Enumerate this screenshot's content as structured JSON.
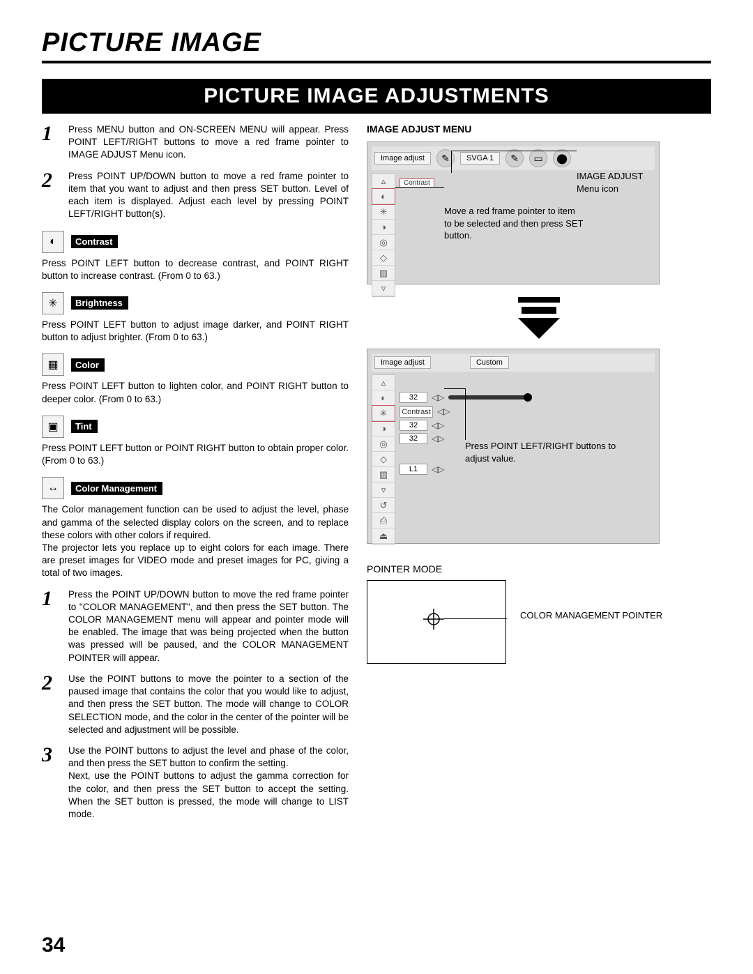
{
  "page_title": "PICTURE IMAGE",
  "section_banner": "PICTURE IMAGE ADJUSTMENTS",
  "page_number": "34",
  "steps_a": [
    {
      "num": "1",
      "text": "Press MENU button and ON-SCREEN MENU will appear.  Press POINT LEFT/RIGHT buttons to move a red frame pointer to IMAGE ADJUST Menu icon."
    },
    {
      "num": "2",
      "text": "Press POINT UP/DOWN button to move a red frame pointer to item that you want to adjust and then press SET button. Level of each item is displayed.  Adjust each level by pressing POINT LEFT/RIGHT button(s)."
    }
  ],
  "adjustments": [
    {
      "icon": "◐",
      "label": "Contrast",
      "text": "Press POINT LEFT button to decrease contrast, and POINT RIGHT button to increase contrast.  (From 0 to 63.)"
    },
    {
      "icon": "✳",
      "label": "Brightness",
      "text": "Press POINT LEFT button to adjust image darker, and POINT RIGHT button to adjust brighter.  (From 0 to 63.)"
    },
    {
      "icon": "▦",
      "label": "Color",
      "text": "Press POINT LEFT button to lighten color, and POINT RIGHT button to deeper color.  (From 0 to 63.)"
    },
    {
      "icon": "▣",
      "label": "Tint",
      "text": "Press POINT LEFT button or POINT RIGHT button to obtain proper color.  (From 0 to 63.)"
    },
    {
      "icon": "↔",
      "label": "Color Management",
      "text": "The Color management function can be used to adjust the level, phase and gamma of the selected display colors on the screen, and to replace these colors with other colors if required.\nThe projector lets you replace up to eight colors for each image. There are preset images for VIDEO mode and preset images for PC, giving a total of two images."
    }
  ],
  "steps_b": [
    {
      "num": "1",
      "text": "Press the POINT UP/DOWN button to move the red frame pointer to \"COLOR MANAGEMENT\", and then press the SET button. The COLOR MANAGEMENT menu will appear and pointer mode will be enabled. The image that was being projected when the button was pressed will be paused, and the COLOR MANAGEMENT POINTER will appear."
    },
    {
      "num": "2",
      "text": "Use the POINT buttons to move the pointer to a section of the paused image that contains the color that you would like to adjust, and then press the SET button. The mode will change to COLOR SELECTION mode, and the color in the center of the pointer will be selected and adjustment will be possible."
    },
    {
      "num": "3",
      "text": "Use the POINT buttons to adjust the level and phase of the color, and then press the SET button to confirm the setting.\nNext, use the POINT buttons to adjust the gamma correction for the color, and then press the SET button to accept the setting. When the SET button is pressed, the mode will change to LIST mode."
    }
  ],
  "right_heading": "IMAGE ADJUST MENU",
  "menu1": {
    "tab1": "Image adjust",
    "tab2": "SVGA 1",
    "contrast_tag": "Contrast",
    "annot_icon": "IMAGE ADJUST\nMenu icon",
    "annot_move": "Move a red frame pointer to item to be selected and then press SET button."
  },
  "menu2": {
    "tab1": "Image adjust",
    "tab2": "Custom",
    "vals": [
      "32",
      "",
      "32",
      "32",
      "",
      "L1"
    ],
    "contrast_tag": "Contrast",
    "annot": "Press POINT LEFT/RIGHT buttons to adjust value."
  },
  "pointer": {
    "header": "POINTER MODE",
    "label": "COLOR MANAGEMENT POINTER"
  }
}
